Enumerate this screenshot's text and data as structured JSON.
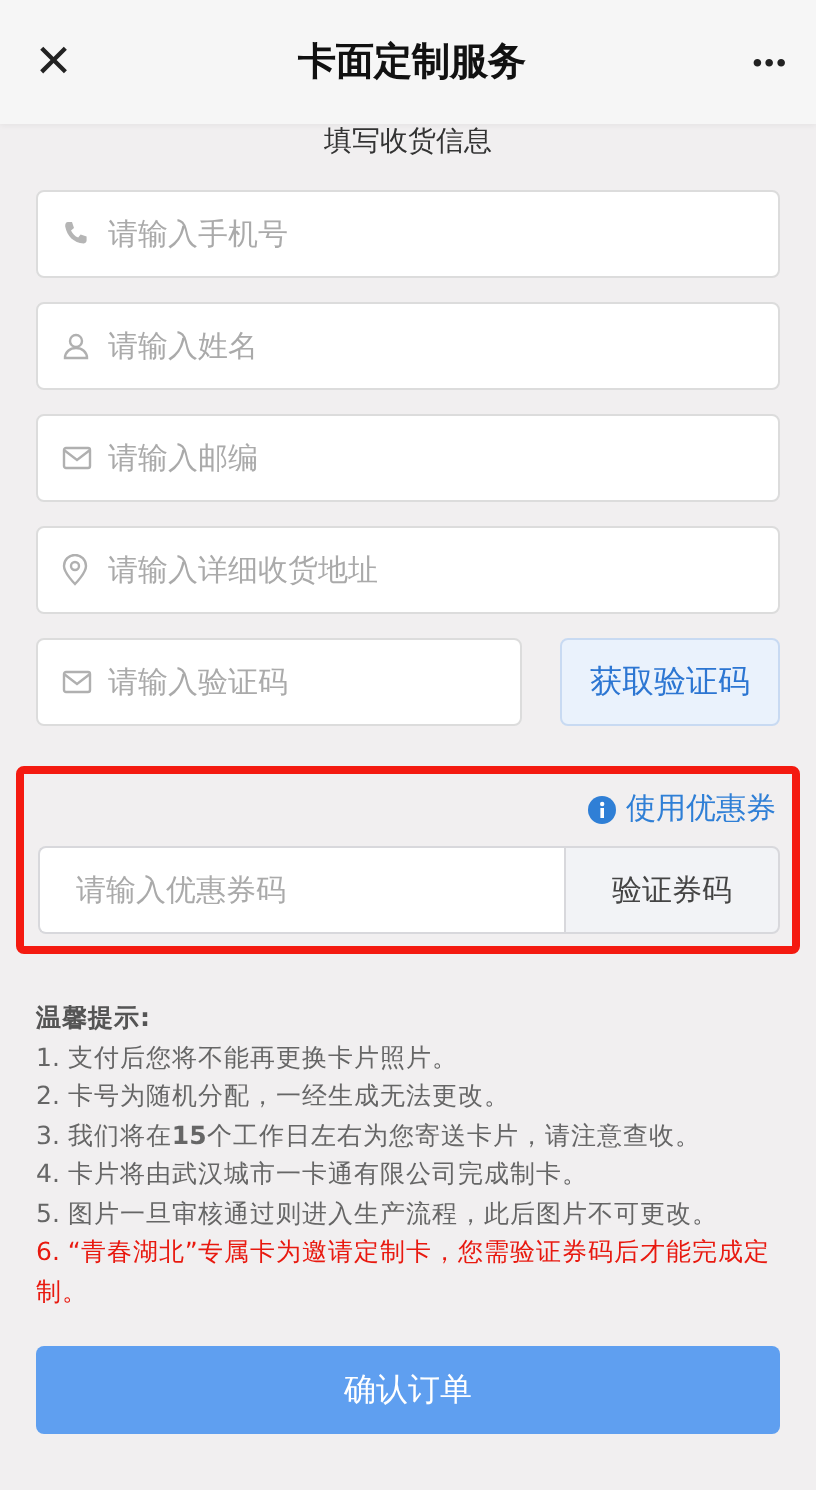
{
  "header": {
    "close": "×",
    "title": "卡面定制服务",
    "more": "•••"
  },
  "section_title": "填写收货信息",
  "fields": [
    {
      "kind": "phone",
      "placeholder": "请输入手机号"
    },
    {
      "kind": "person",
      "placeholder": "请输入姓名"
    },
    {
      "kind": "mail",
      "placeholder": "请输入邮编"
    },
    {
      "kind": "pin",
      "placeholder": "请输入详细收货地址"
    }
  ],
  "verify": {
    "placeholder": "请输入验证码",
    "button": "获取验证码"
  },
  "coupon": {
    "highlighted": true,
    "link": "使用优惠券",
    "placeholder": "请输入优惠券码",
    "button": "验证券码"
  },
  "tips": {
    "title": "温馨提示:",
    "items": [
      {
        "kind": "normal",
        "text": "1. 支付后您将不能再更换卡片照片。"
      },
      {
        "kind": "normal",
        "text": "2. 卡号为随机分配，一经生成无法更改。"
      },
      {
        "kind": "normal",
        "text": "3. 我们将在**15**个工作日左右为您寄送卡片，请注意查收。"
      },
      {
        "kind": "normal",
        "text": "4. 卡片将由武汉城市一卡通有限公司完成制卡。"
      },
      {
        "kind": "normal",
        "text": "5. 图片一旦审核通过则进入生产流程，此后图片不可更改。"
      },
      {
        "kind": "warning",
        "text": "6. “青春湖北”专属卡为邀请定制卡，您需验证券码后才能完成定制。"
      }
    ]
  },
  "confirm": "确认订单"
}
